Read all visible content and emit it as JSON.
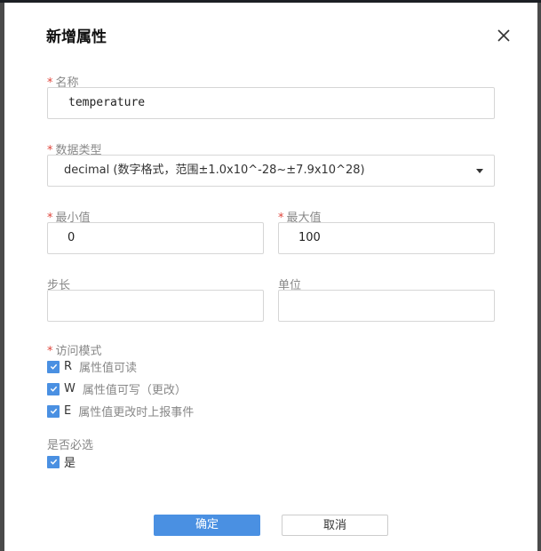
{
  "dialog": {
    "title": "新增属性",
    "name": {
      "label": "名称",
      "value": "temperature"
    },
    "data_type": {
      "label": "数据类型",
      "value": "decimal (数字格式，范围±1.0x10^-28~±7.9x10^28)"
    },
    "min": {
      "label": "最小值",
      "value": "0"
    },
    "max": {
      "label": "最大值",
      "value": "100"
    },
    "step": {
      "label": "步长",
      "value": ""
    },
    "unit": {
      "label": "单位",
      "value": ""
    },
    "access": {
      "label": "访问模式",
      "options": [
        {
          "key": "R",
          "text": "属性值可读",
          "checked": true
        },
        {
          "key": "W",
          "text": "属性值可写（更改）",
          "checked": true
        },
        {
          "key": "E",
          "text": "属性值更改时上报事件",
          "checked": true
        }
      ]
    },
    "required": {
      "label": "是否必选",
      "option": "是",
      "checked": true
    },
    "ok_label": "确定",
    "cancel_label": "取消"
  },
  "colors": {
    "accent": "#4a90e2",
    "required_star": "#e0453b"
  }
}
